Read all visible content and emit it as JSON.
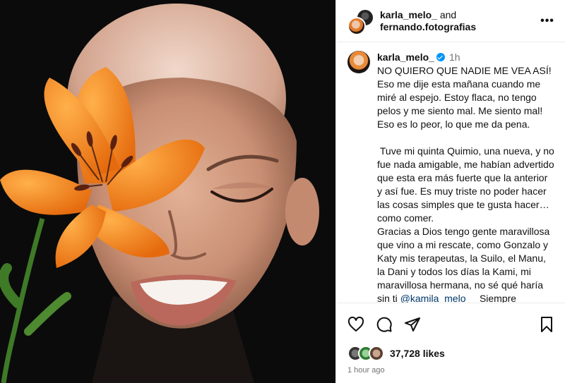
{
  "header": {
    "user1": "karla_melo_",
    "joiner": "and",
    "user2": "fernando.fotografias",
    "more_icon": "more-horizontal-icon"
  },
  "caption": {
    "username": "karla_melo_",
    "verified": true,
    "time": "1h",
    "paragraphs": [
      "NO QUIERO QUE NADIE ME VEA ASÍ!",
      "Eso me dije esta mañana cuando me miré al espejo. Estoy flaca, no tengo pelos y me siento mal. Me siento mal! Eso es lo peor, lo que me da pena.",
      " Tuve mi quinta Quimio, una nueva, y no fue nada amigable, me habían advertido que esta era más fuerte que la anterior y así fue. Es muy triste no poder hacer las cosas simples que te gusta hacer… como comer.",
      "Gracias a Dios tengo gente maravillosa que vino a mi rescate, como Gonzalo y Katy mis terapeutas, la Suilo, el Manu, la Dani y todos los días la Kami, mi maravillosa hermana, no sé qué haría sin ti"
    ],
    "mention": "@kamila_melo__",
    "after_mention": " Siempre agradezco porque esto me pasó a mí y no a ti."
  },
  "actions": {
    "like_icon": "heart-icon",
    "comment_icon": "comment-icon",
    "share_icon": "share-icon",
    "save_icon": "bookmark-icon"
  },
  "likes": {
    "count_text": "37,728 likes"
  },
  "posted": "1 hour ago",
  "colors": {
    "verified": "#0095f6",
    "mention": "#00376b",
    "muted": "#737373",
    "flower": "#f08a1c"
  }
}
